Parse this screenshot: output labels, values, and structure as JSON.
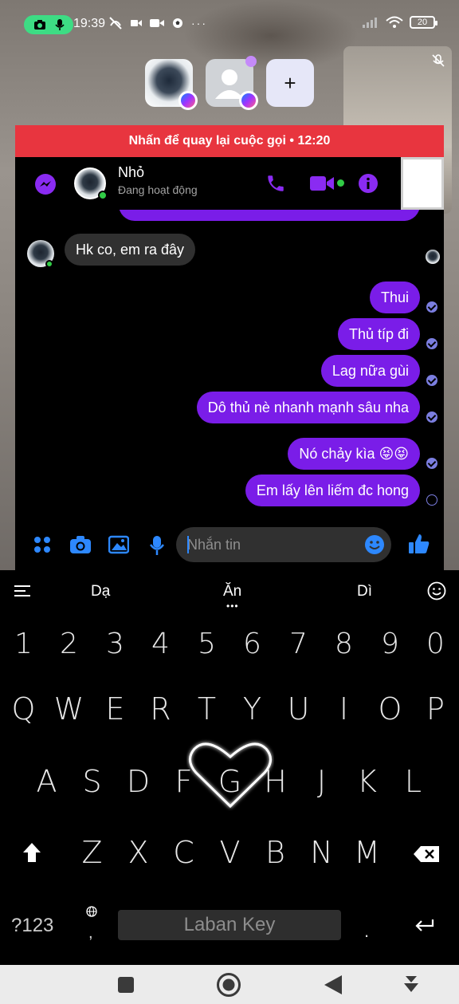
{
  "status_bar": {
    "time": "19:39",
    "battery": "20"
  },
  "call": {
    "add_label": "+",
    "return_banner": "Nhấn để quay lại cuộc gọi • 12:20"
  },
  "chat_header": {
    "name": "Nhỏ",
    "status": "Đang hoạt động"
  },
  "messages": [
    {
      "side": "in",
      "text": "Hk co, em ra đây"
    },
    {
      "side": "out",
      "text": "Thui"
    },
    {
      "side": "out",
      "text": "Thủ típ đi"
    },
    {
      "side": "out",
      "text": "Lag nữa gùi"
    },
    {
      "side": "out",
      "text": "Dô thủ nè nhanh mạnh sâu nha"
    },
    {
      "side": "out",
      "text": "Nó chảy kìa 😝😝"
    },
    {
      "side": "out",
      "text": "Em lấy lên liếm đc hong"
    }
  ],
  "composer": {
    "placeholder": "Nhắn tin"
  },
  "keyboard": {
    "suggestions": [
      "Dạ",
      "Ăn",
      "Dì"
    ],
    "number_row": [
      "1",
      "2",
      "3",
      "4",
      "5",
      "6",
      "7",
      "8",
      "9",
      "0"
    ],
    "row1": [
      "Q",
      "W",
      "E",
      "R",
      "T",
      "Y",
      "U",
      "I",
      "O",
      "P"
    ],
    "row2": [
      "A",
      "S",
      "D",
      "F",
      "G",
      "H",
      "J",
      "K",
      "L"
    ],
    "row3": [
      "Z",
      "X",
      "C",
      "V",
      "B",
      "N",
      "M"
    ],
    "symbols_key": "?123",
    "comma_key": ",",
    "space_label": "Laban Key",
    "period_key": "."
  },
  "colors": {
    "accent": "#7a1de8",
    "banner": "#e8353f",
    "link_blue": "#2d88ff"
  }
}
